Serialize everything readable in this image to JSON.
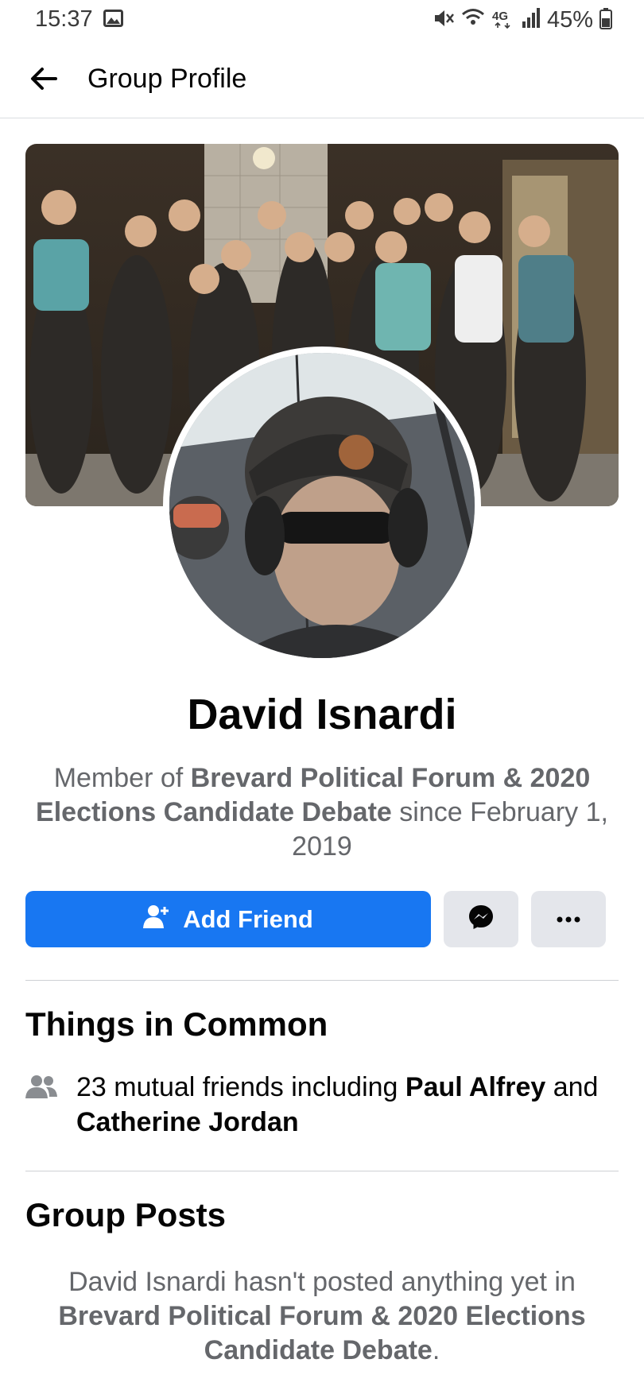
{
  "status_bar": {
    "time": "15:37",
    "icons": [
      "gallery-icon",
      "mute-icon",
      "wifi-icon",
      "4g-icon",
      "signal-icon"
    ],
    "battery": "45%"
  },
  "header": {
    "title": "Group Profile",
    "back_icon": "back-arrow-icon"
  },
  "profile": {
    "name": "David Isnardi",
    "member_prefix": "Member of ",
    "group_name": "Brevard Political Forum & 2020 Elections Candidate Debate",
    "member_suffix": " since February 1, 2019"
  },
  "actions": {
    "add_friend_label": "Add Friend",
    "add_friend_icon": "add-friend-icon",
    "messenger_icon": "messenger-icon",
    "more_icon": "more-dots-icon"
  },
  "things_in_common": {
    "title": "Things in Common",
    "icon": "mutual-friends-icon",
    "prefix": "23 mutual friends including ",
    "friend_1": "Paul Alfrey",
    "joiner": " and ",
    "friend_2": "Catherine Jordan"
  },
  "group_posts": {
    "title": "Group Posts",
    "empty_prefix": "David Isnardi hasn't posted anything yet in ",
    "group_name": "Brevard Political Forum & 2020 Elections Candidate Debate",
    "empty_suffix": "."
  },
  "colors": {
    "accent": "#1877f2",
    "secondary_button": "#e4e6eb",
    "secondary_text": "#65676b",
    "primary_text": "#050505",
    "divider": "#ced0d4"
  }
}
